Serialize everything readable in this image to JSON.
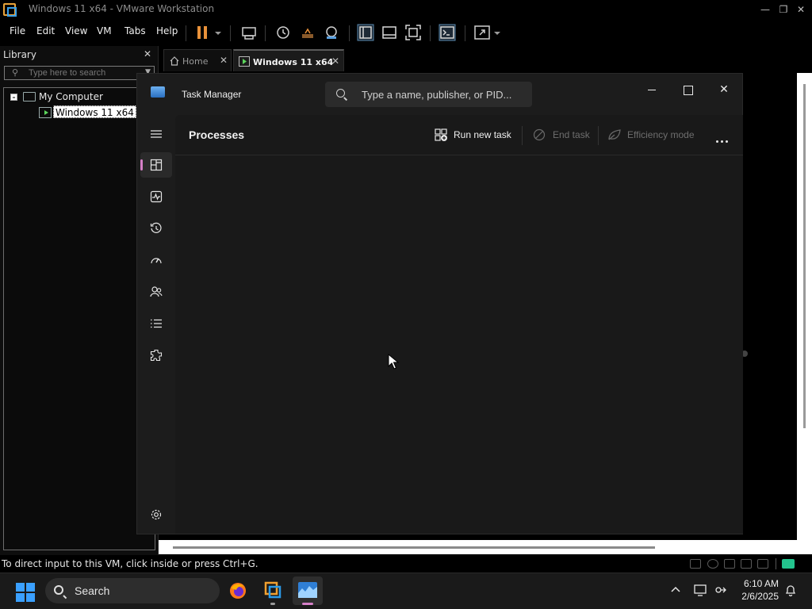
{
  "vmware": {
    "window_title": "Windows 11 x64 - VMware Workstation",
    "menus": [
      "File",
      "Edit",
      "View",
      "VM",
      "Tabs",
      "Help"
    ],
    "library": {
      "header": "Library",
      "search_placeholder": "Type here to search",
      "tree": {
        "root_label": "My Computer",
        "vm_label": "Windows 11 x64"
      }
    },
    "tabs": [
      {
        "label": "Home"
      },
      {
        "label": "Windows 11 x64"
      }
    ],
    "status_text": "To direct input to this VM, click inside or press Ctrl+G."
  },
  "task_manager": {
    "title": "Task Manager",
    "search_placeholder": "Type a name, publisher, or PID...",
    "page_title": "Processes",
    "commands": {
      "run_new_task": "Run new task",
      "end_task": "End task",
      "efficiency_mode": "Efficiency mode"
    },
    "nav_items": [
      "processes",
      "performance",
      "app-history",
      "startup-apps",
      "users",
      "details",
      "services"
    ],
    "accent_color": "#d57fc7"
  },
  "taskbar": {
    "search_label": "Search",
    "clock_time": "6:10 AM",
    "clock_date": "2/6/2025"
  }
}
